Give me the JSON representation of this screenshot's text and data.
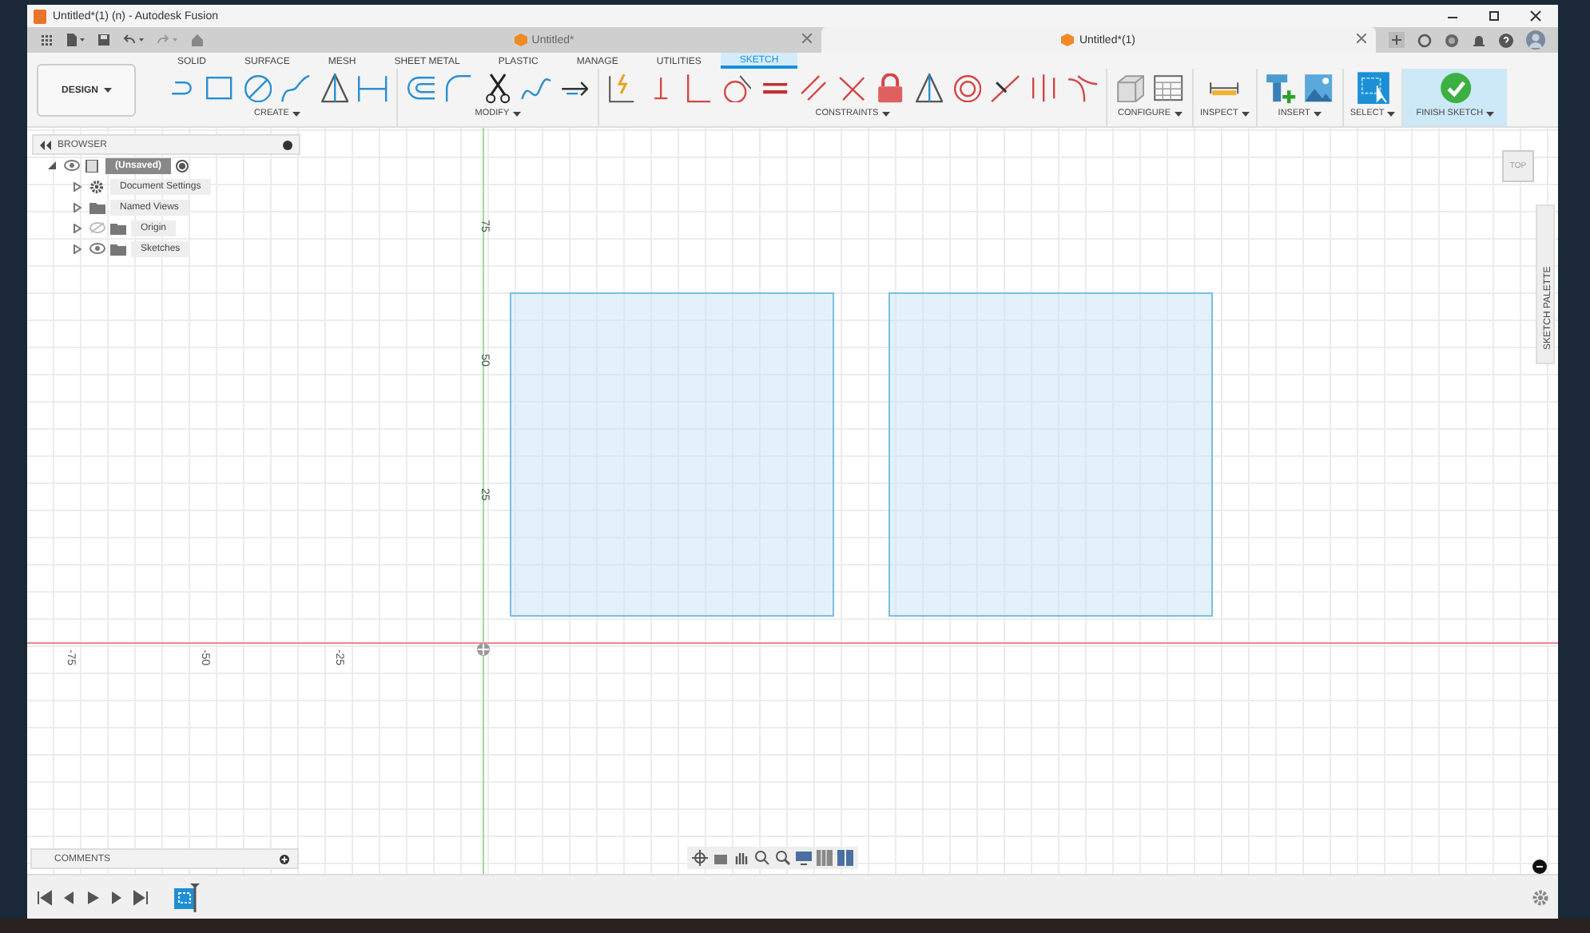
{
  "window": {
    "title": "Untitled*(1) (n) - Autodesk Fusion"
  },
  "document_tabs": [
    {
      "label": "Untitled*",
      "selected": false
    },
    {
      "label": "Untitled*(1)",
      "selected": true
    }
  ],
  "workspace_button": "DESIGN",
  "ribbon_tabs": [
    {
      "label": "SOLID",
      "selected": false
    },
    {
      "label": "SURFACE",
      "selected": false
    },
    {
      "label": "MESH",
      "selected": false
    },
    {
      "label": "SHEET METAL",
      "selected": false
    },
    {
      "label": "PLASTIC",
      "selected": false
    },
    {
      "label": "MANAGE",
      "selected": false
    },
    {
      "label": "UTILITIES",
      "selected": false
    },
    {
      "label": "SKETCH",
      "selected": true
    }
  ],
  "ribbon_groups": [
    {
      "label": "CREATE",
      "highlighted": false,
      "tools": [
        {
          "kind": "line"
        },
        {
          "kind": "rectangle"
        },
        {
          "kind": "circle"
        },
        {
          "kind": "spline"
        },
        {
          "kind": "triangle"
        },
        {
          "kind": "dimension"
        }
      ]
    },
    {
      "label": "MODIFY",
      "highlighted": false,
      "tools": [
        {
          "kind": "offset"
        },
        {
          "kind": "fillet"
        },
        {
          "kind": "scissors"
        },
        {
          "kind": "curve"
        },
        {
          "kind": "arrow"
        }
      ]
    },
    {
      "label": "CONSTRAINTS",
      "highlighted": false,
      "tools": [
        {
          "kind": "project"
        },
        {
          "kind": "coincident"
        },
        {
          "kind": "perpendicular"
        },
        {
          "kind": "tangent"
        },
        {
          "kind": "equal"
        },
        {
          "kind": "parallel"
        },
        {
          "kind": "cross"
        },
        {
          "kind": "lock"
        },
        {
          "kind": "triangle"
        },
        {
          "kind": "concentric"
        },
        {
          "kind": "midpoint"
        },
        {
          "kind": "symmetry"
        },
        {
          "kind": "curvature"
        }
      ]
    },
    {
      "label": "CONFIGURE",
      "highlighted": false,
      "tools": [
        {
          "kind": "cube"
        },
        {
          "kind": "table"
        }
      ]
    },
    {
      "label": "INSPECT",
      "highlighted": false,
      "tools": [
        {
          "kind": "ruler"
        }
      ]
    },
    {
      "label": "INSERT",
      "highlighted": false,
      "tools": [
        {
          "kind": "bolt"
        },
        {
          "kind": "image"
        }
      ]
    },
    {
      "label": "SELECT",
      "highlighted": false,
      "tools": [
        {
          "kind": "select"
        }
      ]
    },
    {
      "label": "FINISH SKETCH",
      "highlighted": true,
      "tools": [
        {
          "kind": "check"
        }
      ]
    }
  ],
  "browser": {
    "title": "BROWSER",
    "tree": [
      {
        "label": "(Unsaved)",
        "kind": "document",
        "visible": true,
        "expanded": true,
        "selected": true,
        "children": [
          {
            "label": "Document Settings",
            "kind": "settings",
            "expanded": false,
            "selected": false
          },
          {
            "label": "Named Views",
            "kind": "folder",
            "expanded": false,
            "selected": false
          },
          {
            "label": "Origin",
            "kind": "folder",
            "visible": false,
            "expanded": false,
            "selected": false
          },
          {
            "label": "Sketches",
            "kind": "folder",
            "visible": true,
            "expanded": false,
            "selected": false
          }
        ]
      }
    ]
  },
  "canvas": {
    "y_axis_labels": [
      "75",
      "50",
      "25"
    ],
    "x_axis_labels": [
      "-75",
      "-50",
      "-25"
    ],
    "view_cube": "TOP",
    "palette_tab": "SKETCH PALETTE"
  },
  "comments": {
    "title": "COMMENTS"
  }
}
